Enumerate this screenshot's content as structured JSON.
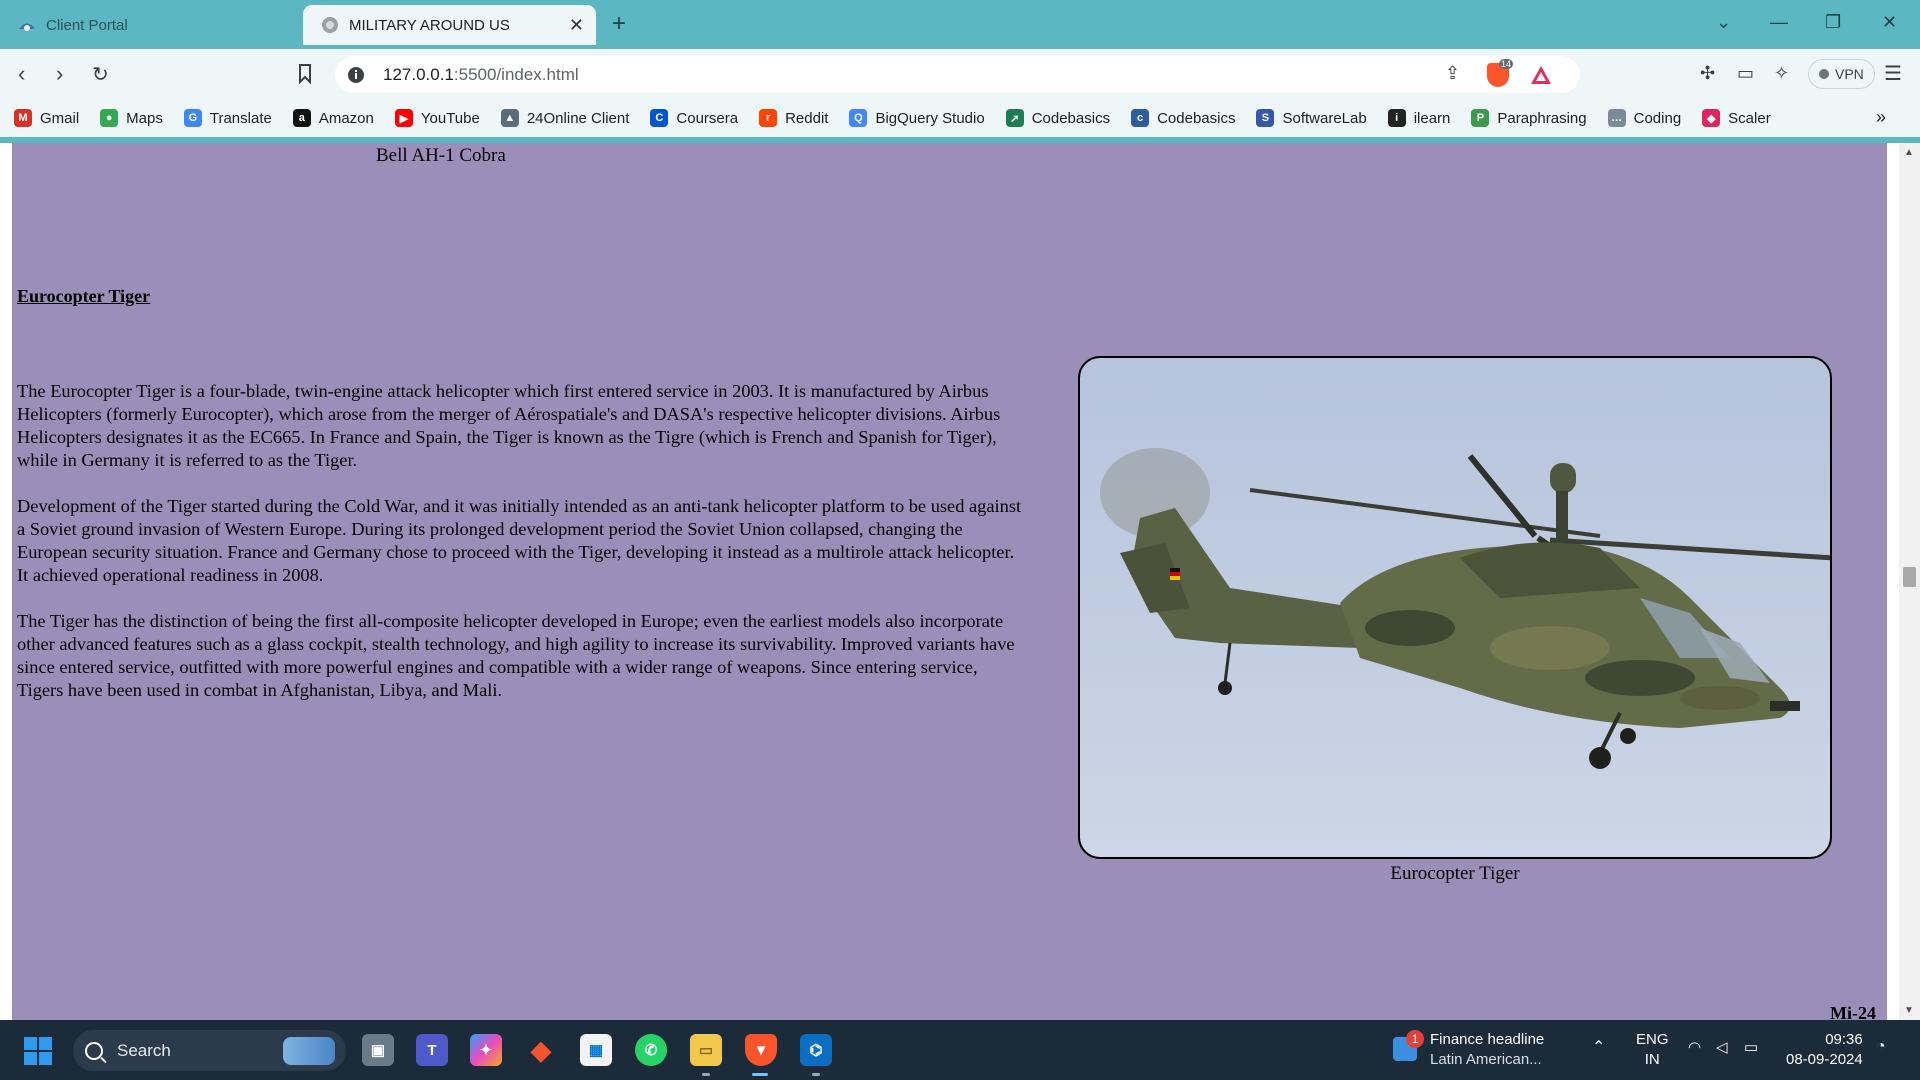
{
  "tabs": [
    {
      "label": "Client Portal",
      "active": false,
      "icon": "client-portal-favicon"
    },
    {
      "label": "MILITARY AROUND US",
      "active": true,
      "icon": "globe-favicon"
    }
  ],
  "address_bar": {
    "host": "127.0.0.1",
    "path": ":5500/index.html"
  },
  "toolbar": {
    "vpn_label": "VPN",
    "shield_count": "14"
  },
  "bookmarks": [
    {
      "label": "Gmail",
      "icon": "gmail-icon",
      "glyph": "M",
      "color": "#d93025"
    },
    {
      "label": "Maps",
      "icon": "maps-icon",
      "glyph": "●",
      "color": "#34a853"
    },
    {
      "label": "Translate",
      "icon": "translate-icon",
      "glyph": "G",
      "color": "#4285f4"
    },
    {
      "label": "Amazon",
      "icon": "amazon-icon",
      "glyph": "a",
      "color": "#111111"
    },
    {
      "label": "YouTube",
      "icon": "youtube-icon",
      "glyph": "▶",
      "color": "#ff0000"
    },
    {
      "label": "24Online Client",
      "icon": "24online-icon",
      "glyph": "▲",
      "color": "#5a6b7b"
    },
    {
      "label": "Coursera",
      "icon": "coursera-icon",
      "glyph": "C",
      "color": "#0056d2"
    },
    {
      "label": "Reddit",
      "icon": "reddit-icon",
      "glyph": "r",
      "color": "#ff4500"
    },
    {
      "label": "BigQuery Studio",
      "icon": "bigquery-icon",
      "glyph": "Q",
      "color": "#4386fa"
    },
    {
      "label": "Codebasics",
      "icon": "codebasics-rocket-icon",
      "glyph": "➚",
      "color": "#1c7c54"
    },
    {
      "label": "Codebasics",
      "icon": "codebasics-icon",
      "glyph": "c",
      "color": "#2d5d9f"
    },
    {
      "label": "SoftwareLab",
      "icon": "softwarelab-icon",
      "glyph": "S",
      "color": "#3558a8"
    },
    {
      "label": "ilearn",
      "icon": "ilearn-icon",
      "glyph": "i",
      "color": "#222222"
    },
    {
      "label": "Paraphrasing",
      "icon": "paraphrasing-icon",
      "glyph": "P",
      "color": "#3c9a4c"
    },
    {
      "label": "Coding",
      "icon": "coding-icon",
      "glyph": "…",
      "color": "#7a8a99"
    },
    {
      "label": "Scaler",
      "icon": "scaler-icon",
      "glyph": "◆",
      "color": "#e0245e"
    }
  ],
  "page": {
    "previous_caption": "Bell AH-1 Cobra",
    "section_heading": "Eurocopter Tiger",
    "paragraphs": [
      "The Eurocopter Tiger is a four-blade, twin-engine attack helicopter which first entered service in 2003. It is manufactured by Airbus Helicopters (formerly Eurocopter), which arose from the merger of Aérospatiale's and DASA's respective helicopter divisions. Airbus Helicopters designates it as the EC665. In France and Spain, the Tiger is known as the Tigre (which is French and Spanish for Tiger), while in Germany it is referred to as the Tiger.",
      "Development of the Tiger started during the Cold War, and it was initially intended as an anti-tank helicopter platform to be used against a Soviet ground invasion of Western Europe. During its prolonged development period the Soviet Union collapsed, changing the European security situation. France and Germany chose to proceed with the Tiger, developing it instead as a multirole attack helicopter. It achieved operational readiness in 2008.",
      "The Tiger has the distinction of being the first all-composite helicopter developed in Europe; even the earliest models also incorporate other advanced features such as a glass cockpit, stealth technology, and high agility to increase its survivability. Improved variants have since entered service, outfitted with more powerful engines and compatible with a wider range of weapons. Since entering service, Tigers have been used in combat in Afghanistan, Libya, and Mali."
    ],
    "figure_caption": "Eurocopter Tiger",
    "next_heading": "Mi-24",
    "background_color": "#9b8fb9"
  },
  "taskbar": {
    "search_label": "Search",
    "news_title": "Finance headline",
    "news_subtitle": "Latin American...",
    "news_badge": "1",
    "lang_top": "ENG",
    "lang_bottom": "IN",
    "time": "09:36",
    "date": "08-09-2024"
  }
}
